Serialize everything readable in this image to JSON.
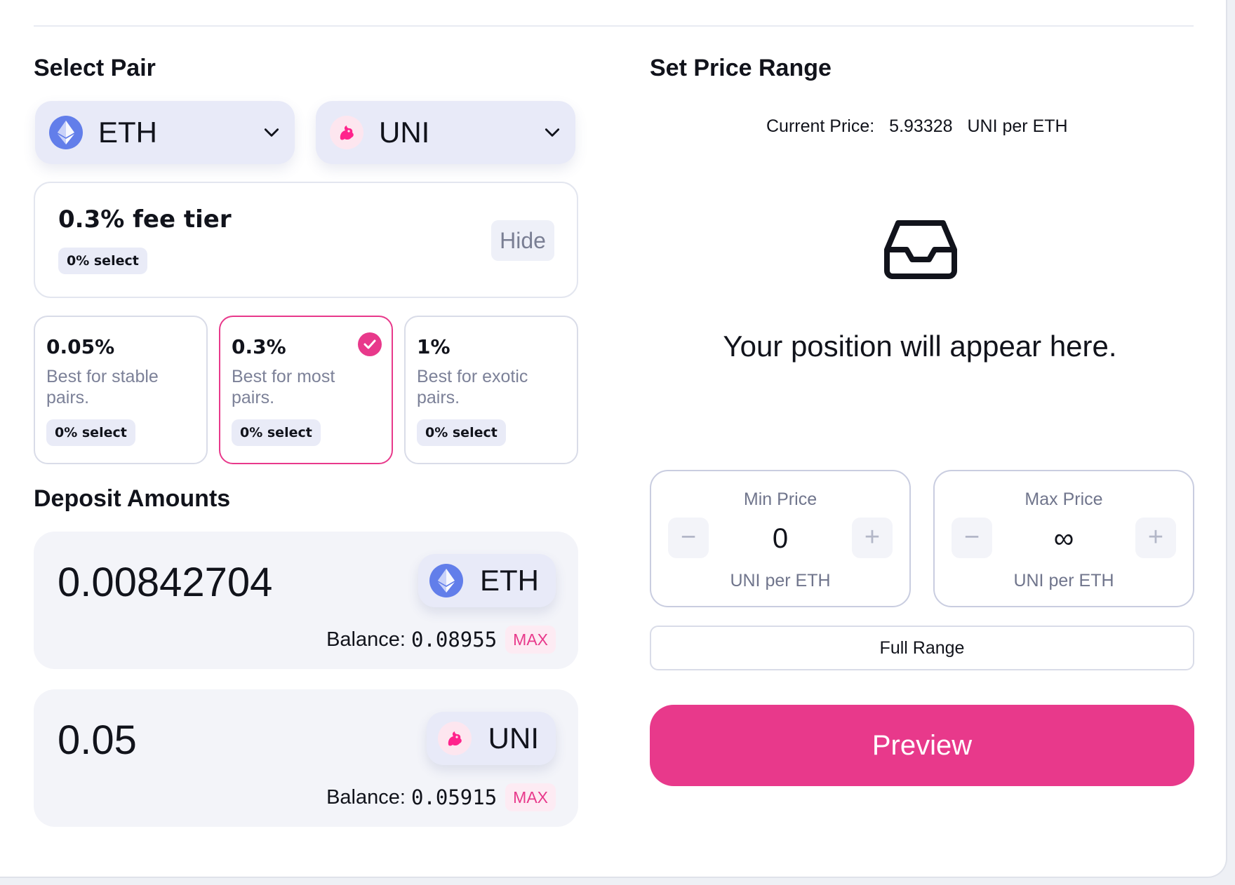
{
  "select_pair": {
    "title": "Select Pair",
    "token_a": {
      "symbol": "ETH",
      "icon": "eth-logo-icon"
    },
    "token_b": {
      "symbol": "UNI",
      "icon": "uni-logo-icon"
    }
  },
  "fee_tier": {
    "title": "0.3% fee tier",
    "selection_badge": "0% select",
    "hide_label": "Hide",
    "options": [
      {
        "pct": "0.05%",
        "desc": "Best for stable pairs.",
        "badge": "0% select",
        "selected": false
      },
      {
        "pct": "0.3%",
        "desc": "Best for most pairs.",
        "badge": "0% select",
        "selected": true
      },
      {
        "pct": "1%",
        "desc": "Best for exotic pairs.",
        "badge": "0% select",
        "selected": false
      }
    ]
  },
  "deposit": {
    "title": "Deposit Amounts",
    "balance_label": "Balance:",
    "max_label": "MAX",
    "items": [
      {
        "amount": "0.00842704",
        "symbol": "ETH",
        "balance": "0.08955"
      },
      {
        "amount": "0.05",
        "symbol": "UNI",
        "balance": "0.05915"
      }
    ]
  },
  "price_range": {
    "title": "Set Price Range",
    "current_price_label": "Current Price:",
    "current_price_value": "5.93328",
    "current_price_unit": "UNI per ETH",
    "empty_message": "Your position will appear here.",
    "min": {
      "label": "Min Price",
      "value": "0",
      "unit": "UNI per ETH"
    },
    "max": {
      "label": "Max Price",
      "value": "∞",
      "unit": "UNI per ETH"
    },
    "full_range_label": "Full Range"
  },
  "preview_label": "Preview",
  "colors": {
    "accent": "#e8398b",
    "eth": "#627eea",
    "token_bg": "#e8eaf8"
  }
}
